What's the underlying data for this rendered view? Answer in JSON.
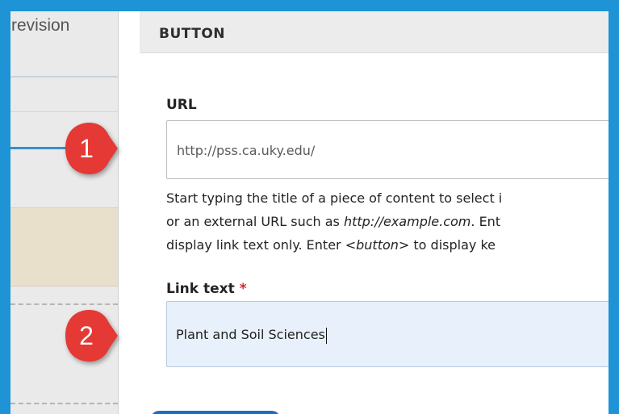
{
  "sidebar": {
    "revision_label": "revision"
  },
  "panel": {
    "title": "BUTTON"
  },
  "url_field": {
    "label": "URL",
    "value": "http://pss.ca.uky.edu/",
    "description": {
      "line1": "Start typing the title of a piece of content to select i",
      "line2_a": "or an external URL such as ",
      "line2_link": "http://example.com",
      "line2_b": ". Ent",
      "line3_a": "display link text only. Enter ",
      "line3_tag": "<button>",
      "line3_b": " to display ke"
    }
  },
  "link_text_field": {
    "label": "Link text",
    "required_marker": "*",
    "value": "Plant and Soil Sciences"
  },
  "callouts": [
    {
      "number": "1"
    },
    {
      "number": "2"
    }
  ],
  "colors": {
    "frame": "#1e93d6",
    "badge": "#e53935",
    "required": "#d6252b",
    "active_field": "#e8f0fb"
  }
}
